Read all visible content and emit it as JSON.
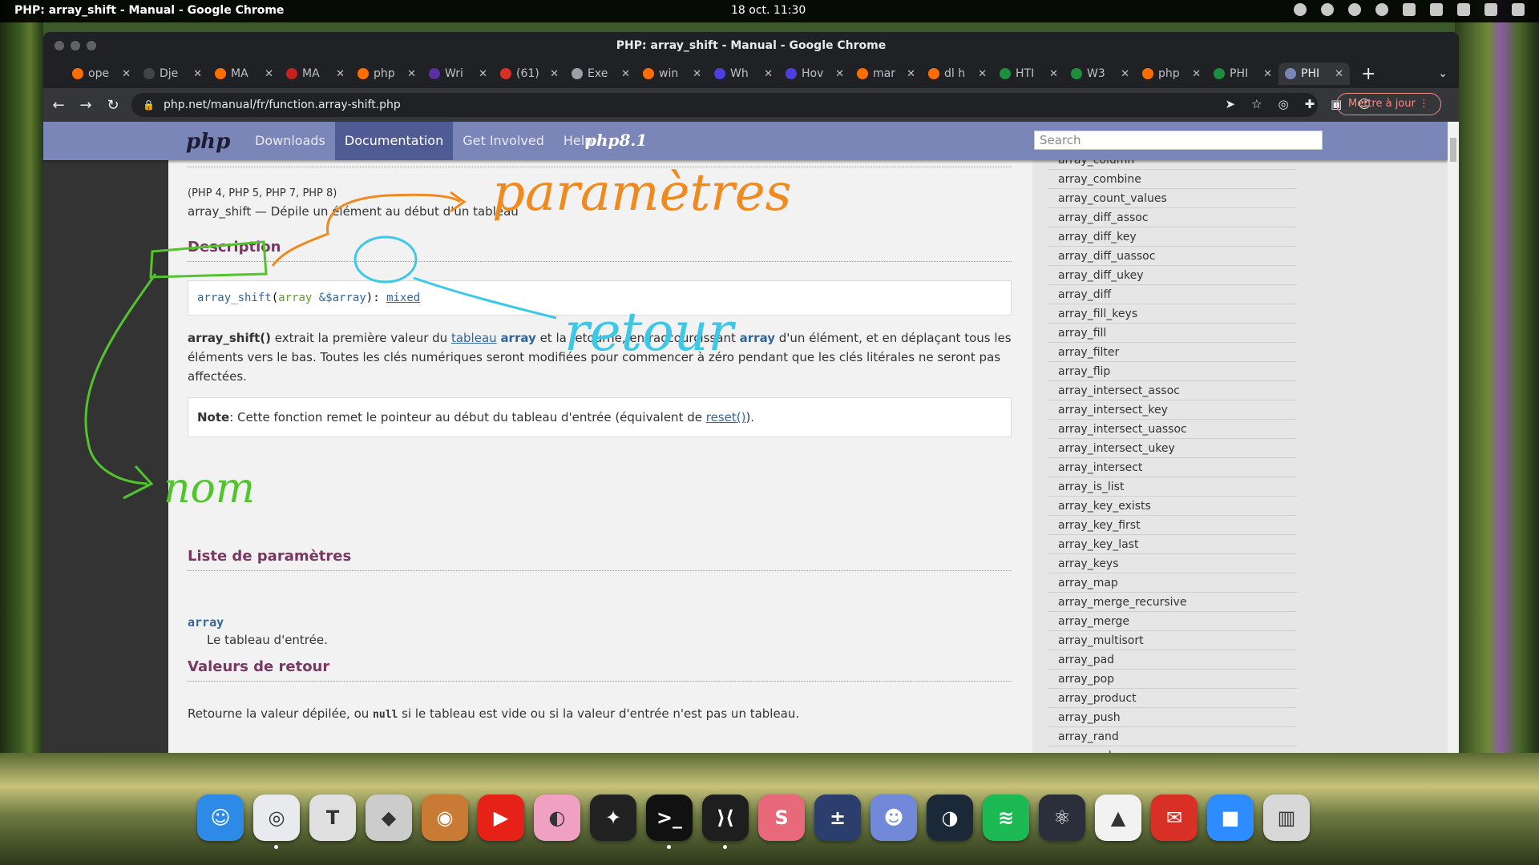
{
  "topbar": {
    "app": "PHP: array_shift - Manual - Google Chrome",
    "clock": "18 oct.  11:30"
  },
  "window": {
    "title": "PHP: array_shift - Manual - Google Chrome"
  },
  "tabs": [
    {
      "label": "ope",
      "fav": "#ff6d00"
    },
    {
      "label": "Dje",
      "fav": "#444444"
    },
    {
      "label": "MA",
      "fav": "#ff6d00"
    },
    {
      "label": "MA",
      "fav": "#c5221f"
    },
    {
      "label": "php",
      "fav": "#ff6d00"
    },
    {
      "label": "Wri",
      "fav": "#5b2fa0"
    },
    {
      "label": "(61)",
      "fav": "#d93025"
    },
    {
      "label": "Exe",
      "fav": "#9aa0a6"
    },
    {
      "label": "win",
      "fav": "#ff6d00"
    },
    {
      "label": "Wh",
      "fav": "#4c3fe0"
    },
    {
      "label": "Hov",
      "fav": "#4c3fe0"
    },
    {
      "label": "mar",
      "fav": "#ff6d00"
    },
    {
      "label": "dl h",
      "fav": "#ff6d00"
    },
    {
      "label": "HTI",
      "fav": "#1e8e3e"
    },
    {
      "label": "W3",
      "fav": "#1e8e3e"
    },
    {
      "label": "php",
      "fav": "#ff6d00"
    },
    {
      "label": "PHI",
      "fav": "#1e8e3e"
    },
    {
      "label": "PHI",
      "fav": "#7a86b8",
      "active": true
    }
  ],
  "toolbar": {
    "url": "php.net/manual/fr/function.array-shift.php",
    "update_label": "Mettre à jour"
  },
  "php": {
    "logo": "php",
    "nav": [
      "Downloads",
      "Documentation",
      "Get Involved",
      "Help"
    ],
    "current_nav": "Documentation",
    "php8": "php8.1",
    "search_placeholder": "Search"
  },
  "doc": {
    "versions": "(PHP 4, PHP 5, PHP 7, PHP 8)",
    "refname": "array_shift — Dépile un élément au début d'un tableau",
    "description_title": "Description",
    "proto": {
      "name": "array_shift",
      "open": "(",
      "type": "array",
      "param": "&$array",
      "close": "): ",
      "ret": "mixed"
    },
    "desc_fn": "array_shift()",
    "desc_1": " extrait la première valeur du ",
    "desc_link": "tableau",
    "desc_arr1": "array",
    "desc_2": " et la retourne, en raccourcissant ",
    "desc_arr2": "array",
    "desc_3": " d'un élément, et en déplaçant tous les éléments vers le bas. Toutes les clés numériques seront modifiées pour commencer à zéro pendant que les clés litérales ne seront pas affectées.",
    "note_label": "Note",
    "note_text": ": Cette fonction remet le pointeur au début du tableau d'entrée (équivalent de ",
    "note_link": "reset()",
    "note_end": ").",
    "params_title": "Liste de paramètres",
    "param_name": "array",
    "param_desc": "Le tableau d'entrée.",
    "return_title": "Valeurs de retour",
    "return_1": "Retourne la valeur dépilée, ou ",
    "return_null": "null",
    "return_2": " si le tableau est vide ou si la valeur d'entrée n'est pas un tableau."
  },
  "sidebar": [
    "array_column",
    "array_combine",
    "array_count_values",
    "array_diff_assoc",
    "array_diff_key",
    "array_diff_uassoc",
    "array_diff_ukey",
    "array_diff",
    "array_fill_keys",
    "array_fill",
    "array_filter",
    "array_flip",
    "array_intersect_assoc",
    "array_intersect_key",
    "array_intersect_uassoc",
    "array_intersect_ukey",
    "array_intersect",
    "array_is_list",
    "array_key_exists",
    "array_key_first",
    "array_key_last",
    "array_keys",
    "array_map",
    "array_merge_recursive",
    "array_merge",
    "array_multisort",
    "array_pad",
    "array_pop",
    "array_product",
    "array_push",
    "array_rand",
    "array_reduce"
  ],
  "annotations": {
    "params": "paramètres",
    "retour": "retour",
    "nom": "nom"
  },
  "dock": [
    {
      "name": "finder",
      "color": "#2d8ae6",
      "glyph": "☺"
    },
    {
      "name": "chrome",
      "color": "#e8eaed",
      "glyph": "◎",
      "running": true
    },
    {
      "name": "typora",
      "color": "#e0e0e0",
      "glyph": "T"
    },
    {
      "name": "inkscape",
      "color": "#cccccc",
      "glyph": "◆"
    },
    {
      "name": "gimp",
      "color": "#c97a35",
      "glyph": "◉"
    },
    {
      "name": "youtube",
      "color": "#e62117",
      "glyph": "▶"
    },
    {
      "name": "screenshot",
      "color": "#f0a0c0",
      "glyph": "◐"
    },
    {
      "name": "figma",
      "color": "#222222",
      "glyph": "✦"
    },
    {
      "name": "terminal",
      "color": "#111111",
      "glyph": ">_",
      "running": true
    },
    {
      "name": "vscode",
      "color": "#1e1e1e",
      "glyph": "⟩⟨",
      "running": true
    },
    {
      "name": "s-app",
      "color": "#e86a7a",
      "glyph": "S"
    },
    {
      "name": "calculator",
      "color": "#2c3e6e",
      "glyph": "±"
    },
    {
      "name": "discord",
      "color": "#7289da",
      "glyph": "☻"
    },
    {
      "name": "steam",
      "color": "#1b2838",
      "glyph": "◑"
    },
    {
      "name": "spotify",
      "color": "#1db954",
      "glyph": "≋"
    },
    {
      "name": "electron",
      "color": "#2b2e3b",
      "glyph": "⚛"
    },
    {
      "name": "drive",
      "color": "#f2f2f2",
      "glyph": "▲"
    },
    {
      "name": "gmail",
      "color": "#d93025",
      "glyph": "✉"
    },
    {
      "name": "zoom",
      "color": "#2d8cff",
      "glyph": "■"
    },
    {
      "name": "trash",
      "color": "#d8d8d8",
      "glyph": "▥"
    }
  ]
}
